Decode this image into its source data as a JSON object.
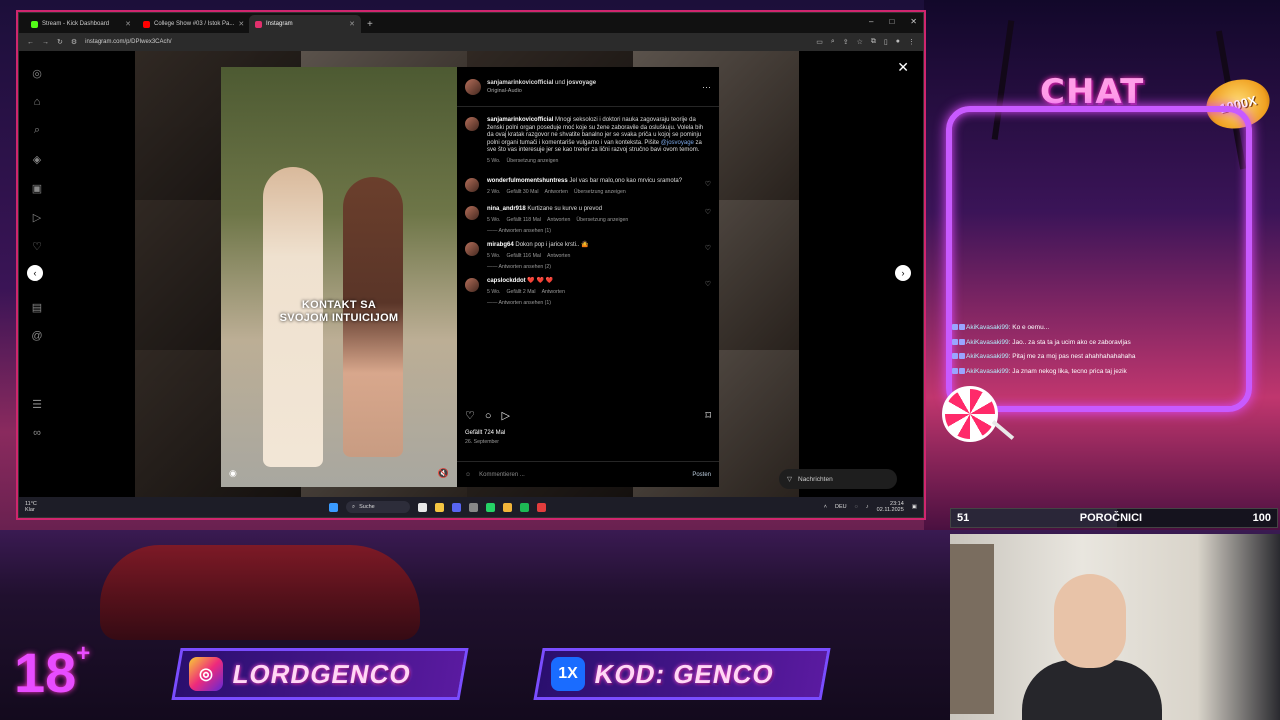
{
  "browser": {
    "tabs": [
      {
        "label": "Stream - Kick Dashboard",
        "color": "#53fc18",
        "active": false
      },
      {
        "label": "College Show #03 / Istok Pa...",
        "color": "#ff0000",
        "active": false
      },
      {
        "label": "Instagram",
        "color": "#e1306c",
        "active": true
      }
    ],
    "new_tab": "+",
    "url": "instagram.com/p/DPIwex3CAch/",
    "window_controls": [
      "–",
      "□",
      "✕"
    ]
  },
  "instagram": {
    "post_caption_overlay": "KONTAKT SA\nSVOJOM INTUICIJOM",
    "header": {
      "author": "sanjamarinkovicofficial",
      "connector": "und",
      "coauthor": "josvoyage",
      "audio": "Original-Audio",
      "more": "···"
    },
    "caption": {
      "user": "sanjamarinkovicofficial",
      "text": "Mnogi seksolozi i doktori nauka zagovaraju teorije da ženski polni organ poseduje moć koje su žene zaboravile da osluškuju. Volela bih da ovaj kratak razgovor ne shvatite banalno jer se svaka priča u kojoj se pominju polni organi tumači i komentariše vulgarno i van konteksta. Pišite",
      "mention": "@josvoyage",
      "text2": "za sve što vas interesuje jer se kao trener za lični razvoj stručno bavi ovom temom.",
      "age": "5 Wo.",
      "translate": "Übersetzung anzeigen"
    },
    "comments": [
      {
        "user": "wonderfulmomentshuntress",
        "text": "Jel vas bar malo,ono kao mrvicu sramota?",
        "age": "2 Wo.",
        "likes": "Gefällt 30 Mal",
        "reply": "Antworten",
        "translate": "Übersetzung anzeigen",
        "more_replies": ""
      },
      {
        "user": "nina_andr918",
        "text": "Kurtizane su kurve u prevod",
        "age": "5 Wo.",
        "likes": "Gefällt 118 Mal",
        "reply": "Antworten",
        "translate": "Übersetzung anzeigen",
        "more_replies": "Antworten ansehen (1)"
      },
      {
        "user": "mirabg64",
        "text": "Dokon pop i jarice krsti.. 🤷",
        "age": "5 Wo.",
        "likes": "Gefällt 116 Mal",
        "reply": "Antworten",
        "translate": "",
        "more_replies": "Antworten ansehen (2)"
      },
      {
        "user": "capslockddot",
        "text": "❤️ ❤️ ❤️",
        "age": "5 Wo.",
        "likes": "Gefällt 2 Mal",
        "reply": "Antworten",
        "translate": "",
        "more_replies": "Antworten ansehen (1)"
      }
    ],
    "likes_total": "Gefällt 724 Mal",
    "date": "26. September",
    "comment_placeholder": "Kommentieren ...",
    "post_button": "Posten",
    "messages_label": "Nachrichten",
    "nav_icons": [
      "instagram-icon",
      "home-icon",
      "search-icon",
      "explore-icon",
      "reels-icon",
      "messages-icon",
      "notifications-icon",
      "create-icon",
      "dashboard-icon",
      "threads-icon",
      "menu-icon",
      "meta-icon"
    ]
  },
  "taskbar": {
    "weather": "11°C",
    "weather_sub": "Klar",
    "search": "Suche",
    "lang": "DEU",
    "time": "23:14",
    "date": "02.11.2025"
  },
  "overlay": {
    "chat_title": "CHAT",
    "badge": "1000X",
    "chat_messages": [
      {
        "user": "AkiKavasaki99",
        "text": "Ko e oemu..."
      },
      {
        "user": "AkiKavasaki99",
        "text": "Jao.. za sta ta ja ucim ako ce zaboravljas"
      },
      {
        "user": "AkiKavasaki99",
        "text": "Pitaj me za moj pas nest ahahhahahahaha"
      },
      {
        "user": "AkiKavasaki99",
        "text": "Ja znam nekog lika, tecno prica taj jezik"
      }
    ],
    "progress": {
      "start": "51",
      "label": "POROČNICI",
      "end": "100",
      "fraction": 0.51
    },
    "age_rating": "18",
    "age_plus": "+",
    "banner_instagram": "LORDGENCO",
    "banner_code": "KOD: GENCO",
    "banner_code_icon": "1X",
    "colors": {
      "neon_pink": "#ff2ec0",
      "neon_purple": "#c85aff",
      "accent_blue": "#7a4dff"
    }
  }
}
